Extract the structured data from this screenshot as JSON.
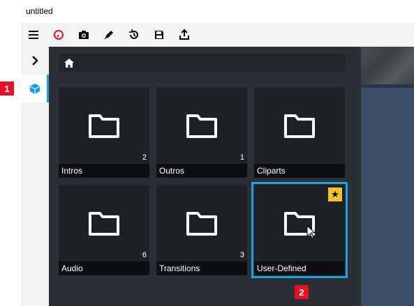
{
  "window": {
    "title": "untitled"
  },
  "toolbar": {
    "items": [
      {
        "name": "menu-icon"
      },
      {
        "name": "record-icon",
        "color": "#e81123"
      },
      {
        "name": "camera-icon"
      },
      {
        "name": "pencil-icon"
      },
      {
        "name": "history-icon"
      },
      {
        "name": "save-icon"
      },
      {
        "name": "export-icon"
      }
    ]
  },
  "sidebar": {
    "items": [
      {
        "name": "chevron-right-icon"
      },
      {
        "name": "cube-icon",
        "active": true,
        "color": "#1ba1e2"
      }
    ]
  },
  "breadcrumb": {
    "icon": "home-icon"
  },
  "folders": [
    {
      "label": "Intros",
      "count": "2"
    },
    {
      "label": "Outros",
      "count": "1"
    },
    {
      "label": "Cliparts",
      "count": ""
    },
    {
      "label": "Audio",
      "count": "6"
    },
    {
      "label": "Transitions",
      "count": "3"
    },
    {
      "label": "User-Defined",
      "count": "",
      "selected": true,
      "favorite": "★"
    }
  ],
  "annotations": [
    {
      "label": "1"
    },
    {
      "label": "2"
    }
  ],
  "colors": {
    "accent": "#1ba1e2",
    "badge": "#e81123",
    "favorite": "#f2c12e",
    "panel": "#2b2f36",
    "tile": "#1e2126"
  }
}
